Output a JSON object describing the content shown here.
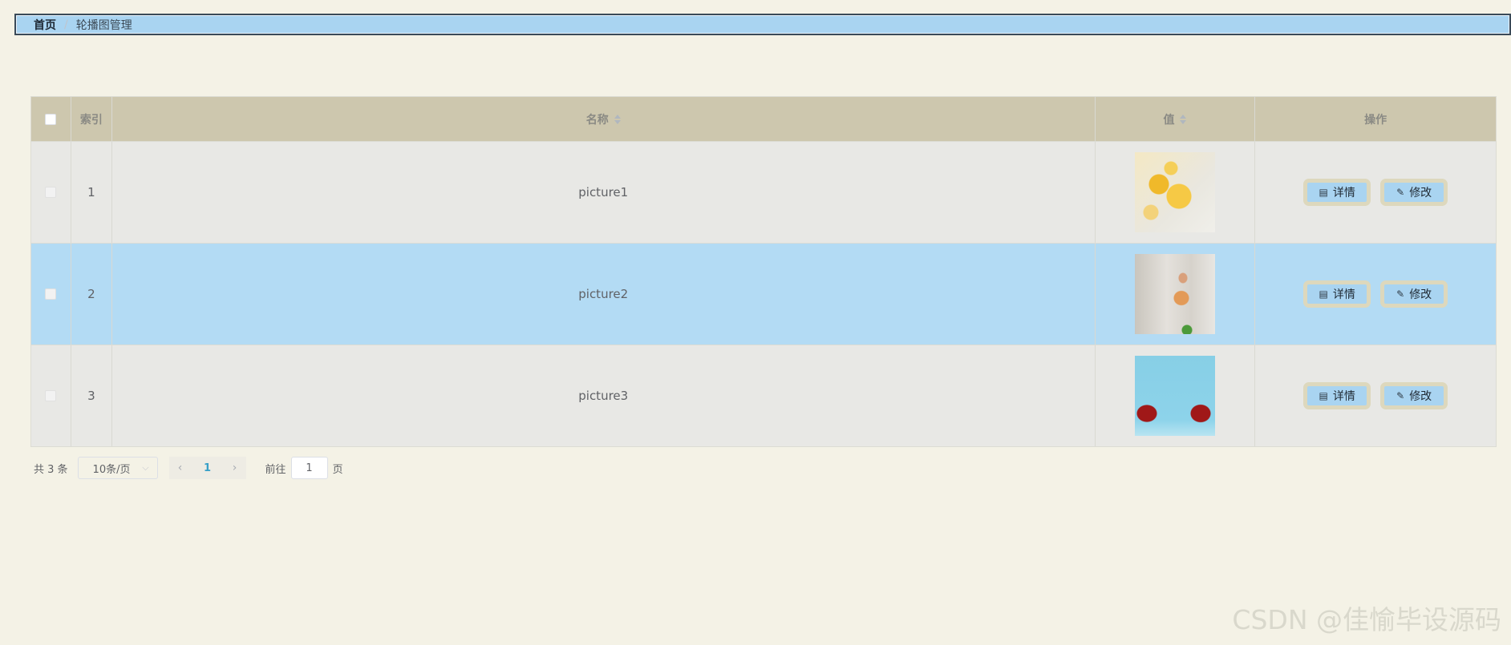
{
  "breadcrumb": {
    "home": "首页",
    "separator": "/",
    "current": "轮播图管理"
  },
  "table": {
    "headers": {
      "index": "索引",
      "name": "名称",
      "value": "值",
      "ops": "操作"
    },
    "rows": [
      {
        "index": "1",
        "name": "picture1",
        "highlighted": false
      },
      {
        "index": "2",
        "name": "picture2",
        "highlighted": true
      },
      {
        "index": "3",
        "name": "picture3",
        "highlighted": false
      }
    ],
    "buttons": {
      "detail": "详情",
      "edit": "修改"
    }
  },
  "pagination": {
    "total": "共 3 条",
    "page_size": "10条/页",
    "current_page": "1",
    "goto_prefix": "前往",
    "goto_value": "1",
    "goto_suffix": "页"
  },
  "watermark": "CSDN @佳愉毕设源码",
  "colors": {
    "background": "#f4f2e6",
    "header_bg": "#cdc7ae",
    "highlight_row": "#b3dbf4",
    "button_bg": "#a9d4f1"
  }
}
